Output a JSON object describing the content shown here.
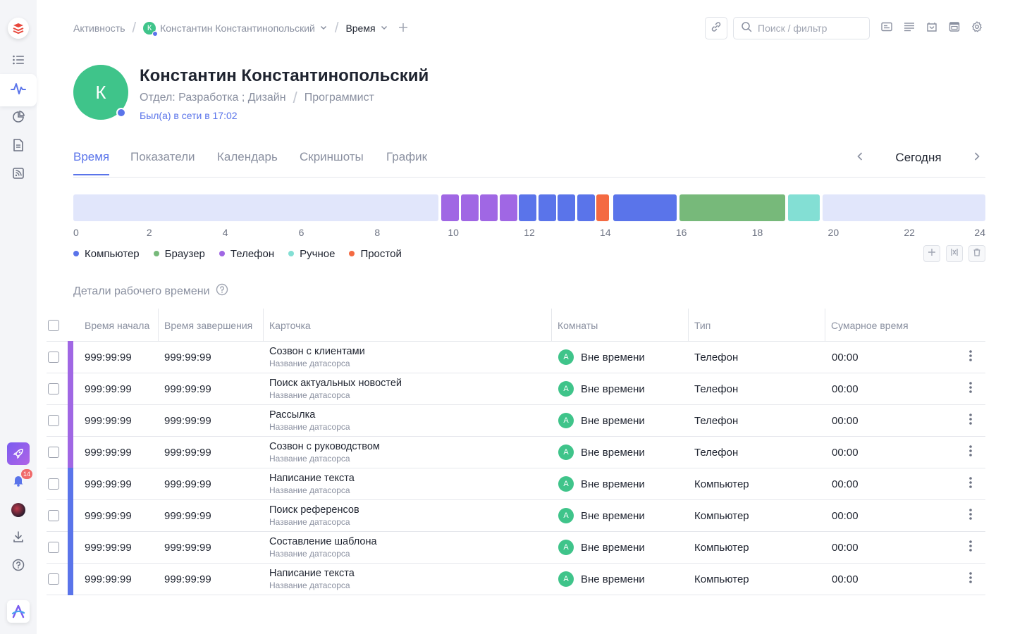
{
  "colors": {
    "accent": "#5a74ea",
    "computer": "#5a74ea",
    "browser": "#77b97a",
    "phone": "#a067e4",
    "manual": "#83dfd4",
    "idle": "#f46a42",
    "empty": "#e1e6fb",
    "avatar": "#3fc48a"
  },
  "sidebar": {
    "items": [
      {
        "name": "logo-icon"
      },
      {
        "name": "list-icon"
      },
      {
        "name": "activity-icon",
        "active": true
      },
      {
        "name": "pie-chart-icon"
      },
      {
        "name": "document-icon"
      },
      {
        "name": "rss-icon"
      }
    ],
    "notifications_count": "14"
  },
  "breadcrumb": {
    "root": "Активность",
    "user_initial": "К",
    "user_name": "Константин Константинопольский",
    "current": "Время"
  },
  "search": {
    "placeholder": "Поиск / фильтр"
  },
  "profile": {
    "initial": "К",
    "name": "Константин Константинопольский",
    "department": "Отдел: Разработка ; Дизайн",
    "position": "Программист",
    "last_seen": "Был(а) в сети в 17:02"
  },
  "tabs": [
    {
      "label": "Время",
      "active": true
    },
    {
      "label": "Показатели"
    },
    {
      "label": "Календарь"
    },
    {
      "label": "Скриншоты"
    },
    {
      "label": "График"
    }
  ],
  "date_nav": {
    "label": "Сегодня"
  },
  "timeline": {
    "hours_total": 24,
    "ticks": [
      "0",
      "2",
      "4",
      "6",
      "8",
      "10",
      "12",
      "14",
      "16",
      "18",
      "20",
      "22",
      "24"
    ],
    "segments": [
      {
        "start": 0.0,
        "end": 9.6,
        "type": "empty"
      },
      {
        "start": 9.68,
        "end": 10.15,
        "type": "phone"
      },
      {
        "start": 10.2,
        "end": 10.66,
        "type": "phone"
      },
      {
        "start": 10.71,
        "end": 11.17,
        "type": "phone"
      },
      {
        "start": 11.22,
        "end": 11.68,
        "type": "phone"
      },
      {
        "start": 11.73,
        "end": 12.19,
        "type": "computer"
      },
      {
        "start": 12.24,
        "end": 12.7,
        "type": "computer"
      },
      {
        "start": 12.75,
        "end": 13.21,
        "type": "computer"
      },
      {
        "start": 13.26,
        "end": 13.72,
        "type": "computer"
      },
      {
        "start": 13.77,
        "end": 14.1,
        "type": "idle"
      },
      {
        "start": 14.21,
        "end": 15.88,
        "type": "computer"
      },
      {
        "start": 15.95,
        "end": 18.74,
        "type": "browser"
      },
      {
        "start": 18.81,
        "end": 19.64,
        "type": "manual"
      },
      {
        "start": 19.71,
        "end": 24.0,
        "type": "empty"
      }
    ]
  },
  "legend": [
    {
      "label": "Компьютер",
      "type": "computer"
    },
    {
      "label": "Браузер",
      "type": "browser"
    },
    {
      "label": "Телефон",
      "type": "phone"
    },
    {
      "label": "Ручное",
      "type": "manual"
    },
    {
      "label": "Простой",
      "type": "idle"
    }
  ],
  "section": {
    "title": "Детали рабочего времени"
  },
  "table": {
    "columns": [
      "Время начала",
      "Время завершения",
      "Карточка",
      "Комнаты",
      "Тип",
      "Сумарное время"
    ],
    "rows": [
      {
        "start": "999:99:99",
        "end": "999:99:99",
        "card": "Созвон с клиентами",
        "source": "Название датасорса",
        "room_initial": "А",
        "room": "Вне времени",
        "type": "Телефон",
        "type_key": "phone",
        "total": "00:00"
      },
      {
        "start": "999:99:99",
        "end": "999:99:99",
        "card": "Поиск актуальных новостей",
        "source": "Название датасорса",
        "room_initial": "А",
        "room": "Вне времени",
        "type": "Телефон",
        "type_key": "phone",
        "total": "00:00"
      },
      {
        "start": "999:99:99",
        "end": "999:99:99",
        "card": "Рассылка",
        "source": "Название датасорса",
        "room_initial": "А",
        "room": "Вне времени",
        "type": "Телефон",
        "type_key": "phone",
        "total": "00:00"
      },
      {
        "start": "999:99:99",
        "end": "999:99:99",
        "card": "Созвон с руководством",
        "source": "Название датасорса",
        "room_initial": "А",
        "room": "Вне времени",
        "type": "Телефон",
        "type_key": "phone",
        "total": "00:00"
      },
      {
        "start": "999:99:99",
        "end": "999:99:99",
        "card": "Написание текста",
        "source": "Название датасорса",
        "room_initial": "А",
        "room": "Вне времени",
        "type": "Компьютер",
        "type_key": "computer",
        "total": "00:00"
      },
      {
        "start": "999:99:99",
        "end": "999:99:99",
        "card": "Поиск референсов",
        "source": "Название датасорса",
        "room_initial": "А",
        "room": "Вне времени",
        "type": "Компьютер",
        "type_key": "computer",
        "total": "00:00"
      },
      {
        "start": "999:99:99",
        "end": "999:99:99",
        "card": "Составление шаблона",
        "source": "Название датасорса",
        "room_initial": "А",
        "room": "Вне времени",
        "type": "Компьютер",
        "type_key": "computer",
        "total": "00:00"
      },
      {
        "start": "999:99:99",
        "end": "999:99:99",
        "card": "Написание текста",
        "source": "Название датасорса",
        "room_initial": "А",
        "room": "Вне времени",
        "type": "Компьютер",
        "type_key": "computer",
        "total": "00:00"
      }
    ]
  }
}
